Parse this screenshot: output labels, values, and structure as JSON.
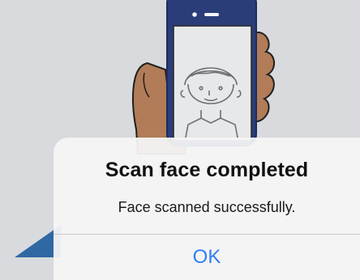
{
  "alert": {
    "title": "Scan face completed",
    "message": "Face scanned successfully.",
    "button_ok": "OK"
  },
  "colors": {
    "background": "#d8dadd",
    "phone_frame": "#2a3d79",
    "hand": "#b17c57",
    "accent_triangle": "#2f68a3",
    "ok_button": "#2f7ff0"
  },
  "icons": {
    "illustration": "face-scan-illustration"
  }
}
